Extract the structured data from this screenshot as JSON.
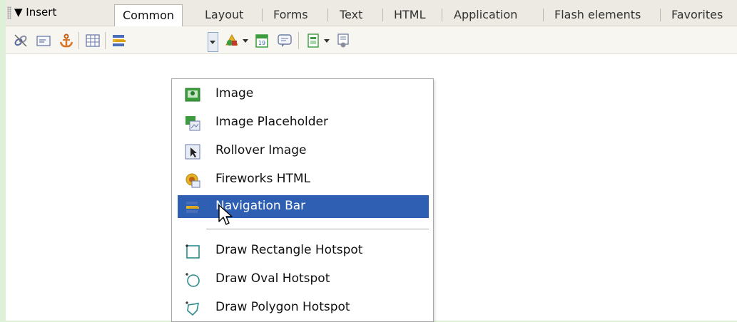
{
  "insert_panel": {
    "label": "▼ Insert"
  },
  "tabs": [
    {
      "label": "Common",
      "active": true
    },
    {
      "label": "Layout",
      "active": false
    },
    {
      "label": "Forms",
      "active": false
    },
    {
      "label": "Text",
      "active": false
    },
    {
      "label": "HTML",
      "active": false
    },
    {
      "label": "Application",
      "active": false
    },
    {
      "label": "Flash elements",
      "active": false
    },
    {
      "label": "Favorites",
      "active": false
    }
  ],
  "toolbar": {
    "icons": [
      "hyperlink-icon",
      "email-link-icon",
      "named-anchor-icon",
      "table-icon",
      "images-icon",
      "media-icon",
      "date-icon",
      "comment-icon",
      "templates-icon",
      "tag-chooser-icon"
    ]
  },
  "images_menu": {
    "items": [
      {
        "label": "Image",
        "icon": "image-icon"
      },
      {
        "label": "Image Placeholder",
        "icon": "image-placeholder-icon"
      },
      {
        "label": "Rollover Image",
        "icon": "rollover-image-icon"
      },
      {
        "label": "Fireworks HTML",
        "icon": "fireworks-html-icon"
      },
      {
        "label": "Navigation Bar",
        "icon": "navigation-bar-icon",
        "selected": true
      },
      {
        "label": "Draw Rectangle Hotspot",
        "icon": "rectangle-hotspot-icon"
      },
      {
        "label": "Draw Oval Hotspot",
        "icon": "oval-hotspot-icon"
      },
      {
        "label": "Draw Polygon Hotspot",
        "icon": "polygon-hotspot-icon"
      }
    ]
  },
  "colors": {
    "selection": "#2f5fb3",
    "background_border": "#dff0d8"
  }
}
